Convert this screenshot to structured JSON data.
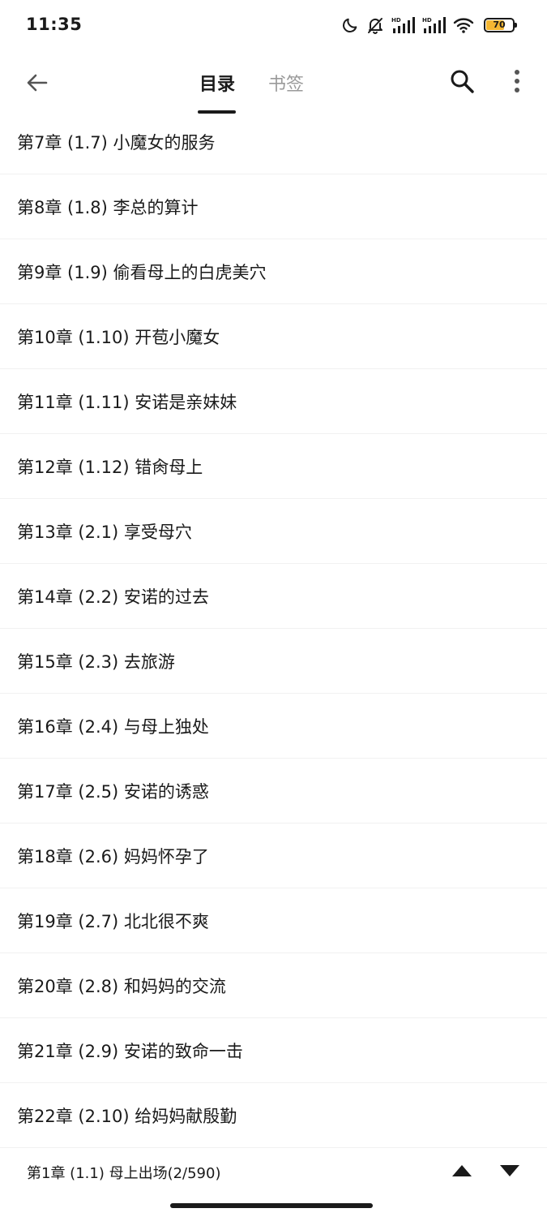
{
  "status_bar": {
    "time": "11:35",
    "battery_level": "70",
    "battery_color": "#f4b632",
    "icons": [
      "moon-icon",
      "bell-off-icon",
      "hd-signal-icon",
      "hd-signal-icon",
      "wifi-icon",
      "battery-icon"
    ]
  },
  "app_bar": {
    "tabs": [
      {
        "label": "目录",
        "active": true
      },
      {
        "label": "书签",
        "active": false
      }
    ],
    "icons": [
      "back-arrow-icon",
      "search-icon",
      "more-vertical-icon"
    ]
  },
  "chapters": [
    "第7章 (1.7) 小魔女的服务",
    "第8章 (1.8) 李总的算计",
    "第9章 (1.9) 偷看母上的白虎美穴",
    "第10章 (1.10) 开苞小魔女",
    "第11章 (1.11) 安诺是亲妹妹",
    "第12章 (1.12) 错肏母上",
    "第13章 (2.1) 享受母穴",
    "第14章 (2.2) 安诺的过去",
    "第15章 (2.3) 去旅游",
    "第16章 (2.4) 与母上独处",
    "第17章 (2.5) 安诺的诱惑",
    "第18章 (2.6) 妈妈怀孕了",
    "第19章 (2.7) 北北很不爽",
    "第20章 (2.8) 和妈妈的交流",
    "第21章 (2.9) 安诺的致命一击",
    "第22章 (2.10) 给妈妈献殷勤"
  ],
  "bottom_bar": {
    "current_chapter": "第1章 (1.1) 母上出场(2/590)",
    "icons": [
      "triangle-up-icon",
      "triangle-down-icon"
    ]
  }
}
